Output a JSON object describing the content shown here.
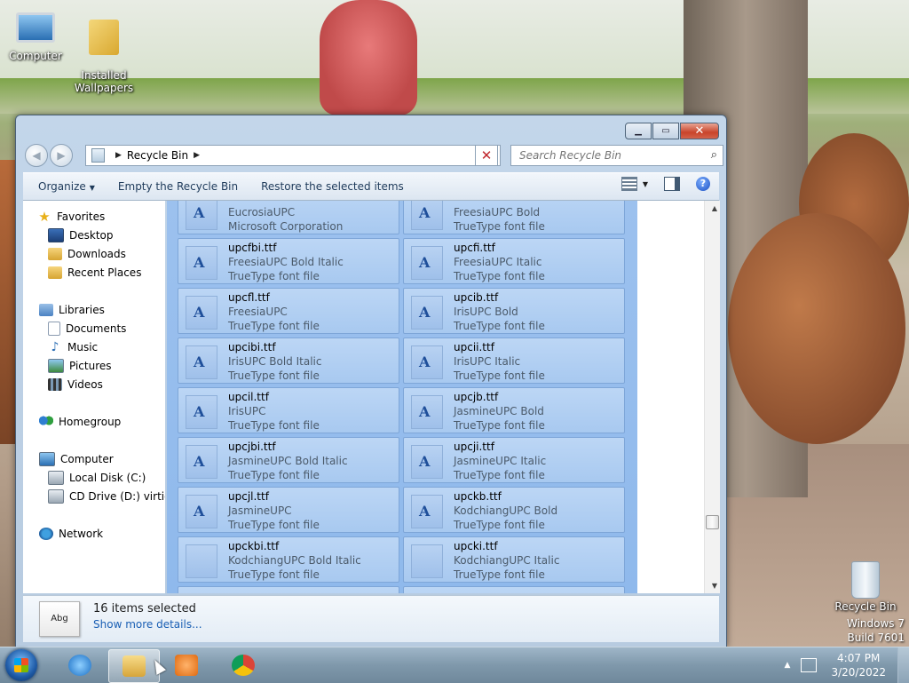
{
  "desktop": {
    "icons": [
      {
        "label": "Computer"
      },
      {
        "label": "Installed\nWallpapers"
      },
      {
        "label": "Recycle Bin"
      }
    ],
    "branding": {
      "line1": "Windows 7",
      "line2": "Build 7601"
    }
  },
  "window": {
    "address": {
      "crumb": "Recycle Bin"
    },
    "search": {
      "placeholder": "Search Recycle Bin"
    },
    "toolbar": {
      "organize": "Organize",
      "empty": "Empty the Recycle Bin",
      "restore": "Restore the selected items"
    },
    "nav": {
      "favorites": "Favorites",
      "desktop": "Desktop",
      "downloads": "Downloads",
      "recent": "Recent Places",
      "libraries": "Libraries",
      "documents": "Documents",
      "music": "Music",
      "pictures": "Pictures",
      "videos": "Videos",
      "homegroup": "Homegroup",
      "computer": "Computer",
      "localdisk": "Local Disk (C:)",
      "cddrive": "CD Drive (D:) virtio-w",
      "network": "Network"
    },
    "files": [
      {
        "name": "",
        "desc": "EucrosiaUPC",
        "type": "Microsoft Corporation"
      },
      {
        "name": "",
        "desc": "FreesiaUPC Bold",
        "type": "TrueType font file"
      },
      {
        "name": "upcfbi.ttf",
        "desc": "FreesiaUPC Bold Italic",
        "type": "TrueType font file"
      },
      {
        "name": "upcfi.ttf",
        "desc": "FreesiaUPC Italic",
        "type": "TrueType font file"
      },
      {
        "name": "upcfl.ttf",
        "desc": "FreesiaUPC",
        "type": "TrueType font file"
      },
      {
        "name": "upcib.ttf",
        "desc": "IrisUPC Bold",
        "type": "TrueType font file"
      },
      {
        "name": "upcibi.ttf",
        "desc": "IrisUPC Bold Italic",
        "type": "TrueType font file"
      },
      {
        "name": "upcii.ttf",
        "desc": "IrisUPC Italic",
        "type": "TrueType font file"
      },
      {
        "name": "upcil.ttf",
        "desc": "IrisUPC",
        "type": "TrueType font file"
      },
      {
        "name": "upcjb.ttf",
        "desc": "JasmineUPC Bold",
        "type": "TrueType font file"
      },
      {
        "name": "upcjbi.ttf",
        "desc": "JasmineUPC Bold Italic",
        "type": "TrueType font file"
      },
      {
        "name": "upcji.ttf",
        "desc": "JasmineUPC Italic",
        "type": "TrueType font file"
      },
      {
        "name": "upcjl.ttf",
        "desc": "JasmineUPC",
        "type": "TrueType font file"
      },
      {
        "name": "upckb.ttf",
        "desc": "KodchiangUPC Bold",
        "type": "TrueType font file"
      },
      {
        "name": "upckbi.ttf",
        "desc": "KodchiangUPC Bold Italic",
        "type": "TrueType font file"
      },
      {
        "name": "upcki.ttf",
        "desc": "KodchiangUPC Italic",
        "type": "TrueType font file"
      }
    ],
    "details": {
      "thumb_label": "Abg",
      "count": "16 items selected",
      "more": "Show more details..."
    }
  },
  "taskbar": {
    "time": "4:07 PM",
    "date": "3/20/2022"
  },
  "colors": {
    "selection": "#a8c9f0",
    "link": "#1a5fb4",
    "close": "#c9442a"
  }
}
